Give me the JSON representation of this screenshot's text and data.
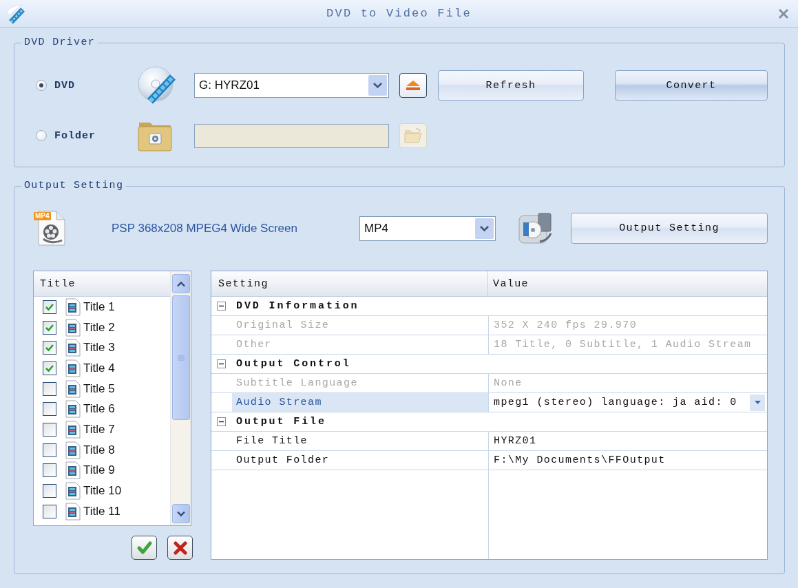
{
  "window": {
    "title": "DVD to Video File"
  },
  "dvd_driver": {
    "legend": "DVD Driver",
    "sources": [
      {
        "kind": "dvd",
        "label": "DVD",
        "selected": true,
        "disabled": false,
        "value": "G: HYRZ01"
      },
      {
        "kind": "folder",
        "label": "Folder",
        "selected": false,
        "disabled": true
      }
    ],
    "buttons": [
      {
        "label": "Refresh",
        "default": false
      },
      {
        "label": "Convert",
        "default": true
      }
    ]
  },
  "output_setting": {
    "legend": "Output Setting",
    "format_badge": "MP4",
    "profile": "PSP 368x208 MPEG4 Wide Screen",
    "format": "MP4",
    "button": "Output Setting"
  },
  "title_list": {
    "header": "Title",
    "items": [
      {
        "label": "Title 1",
        "checked": true
      },
      {
        "label": "Title 2",
        "checked": true
      },
      {
        "label": "Title 3",
        "checked": true
      },
      {
        "label": "Title 4",
        "checked": true
      },
      {
        "label": "Title 5",
        "checked": false
      },
      {
        "label": "Title 6",
        "checked": false
      },
      {
        "label": "Title 7",
        "checked": false
      },
      {
        "label": "Title 8",
        "checked": false
      },
      {
        "label": "Title 9",
        "checked": false
      },
      {
        "label": "Title 10",
        "checked": false
      },
      {
        "label": "Title 11",
        "checked": false
      }
    ]
  },
  "properties": {
    "columns": [
      "Setting",
      "Value"
    ],
    "categories": [
      {
        "label": "DVD Information",
        "expanded": true,
        "rows": [
          {
            "name": "Original Size",
            "value": "352 X 240 fps 29.970",
            "kind": "text",
            "disabled": true,
            "selected": false
          },
          {
            "name": "Other",
            "value": "18 Title, 0 Subtitle, 1 Audio Stream",
            "kind": "text",
            "disabled": true,
            "selected": false
          }
        ]
      },
      {
        "label": "Output Control",
        "expanded": true,
        "rows": [
          {
            "name": "Subtitle Language",
            "value": "None",
            "kind": "text",
            "disabled": true,
            "selected": false
          },
          {
            "name": "Audio Stream",
            "value": "mpeg1 (stereo) language: ja aid: 0",
            "kind": "dropdown",
            "disabled": false,
            "selected": true
          }
        ]
      },
      {
        "label": "Output File",
        "expanded": true,
        "rows": [
          {
            "name": "File Title",
            "value": "HYRZ01",
            "kind": "text",
            "disabled": false,
            "selected": false
          },
          {
            "name": "Output Folder",
            "value": "F:\\My Documents\\FFOutput",
            "kind": "text",
            "disabled": false,
            "selected": false
          }
        ]
      }
    ]
  }
}
